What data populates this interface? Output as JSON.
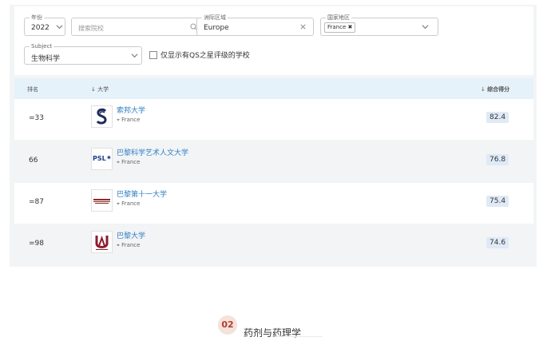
{
  "filters": {
    "year": {
      "legend": "年份",
      "value": "2022"
    },
    "search": {
      "placeholder": "搜索院校"
    },
    "continent": {
      "legend": "洲际区域",
      "value": "Europe"
    },
    "country": {
      "legend": "国家地区",
      "chip": "France"
    },
    "subject": {
      "legend": "Subject",
      "value": "生物科学"
    },
    "qs_only_label": "仅显示有QS之星评级的学校"
  },
  "table": {
    "col_rank": "排名",
    "col_university": "大学",
    "col_score": "综合得分",
    "rows": [
      {
        "rank": "=33",
        "name": "索邦大学",
        "country": "France",
        "score": "82.4"
      },
      {
        "rank": "66",
        "name": "巴黎科学艺术人文大学",
        "country": "France",
        "score": "76.8"
      },
      {
        "rank": "=87",
        "name": "巴黎第十一大学",
        "country": "France",
        "score": "75.4"
      },
      {
        "rank": "=98",
        "name": "巴黎大学",
        "country": "France",
        "score": "74.6"
      }
    ]
  },
  "logos": {
    "psl_text": "PSL"
  },
  "section": {
    "number": "02",
    "title": "药剂与药理学"
  },
  "colors": {
    "link": "#2f7fc1",
    "score_bg": "#dfeaf6",
    "header_bg": "#e6f2fa",
    "accent": "#b43c2b"
  },
  "icons": {
    "sort": "arrow-down-icon",
    "search": "search-icon",
    "clear": "close-icon",
    "dropdown": "chevron-down-icon",
    "location": "pin-icon"
  }
}
